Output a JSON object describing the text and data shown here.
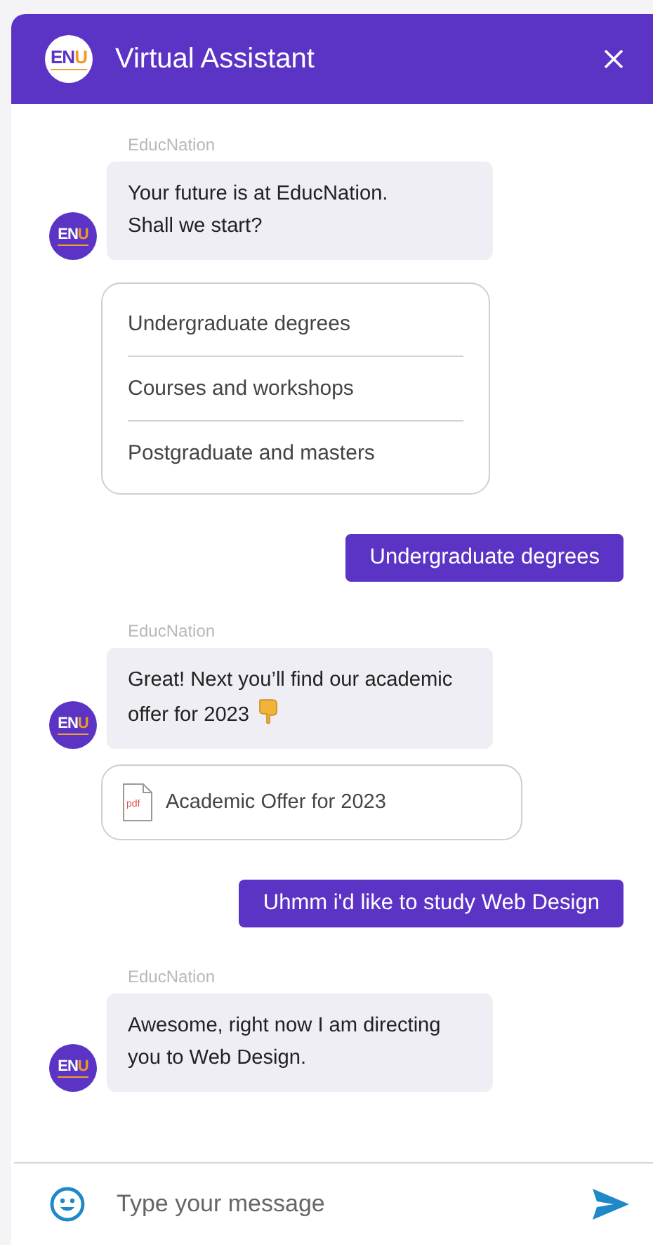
{
  "header": {
    "logo": {
      "main": "EN",
      "accent": "U"
    },
    "title": "Virtual Assistant"
  },
  "messages": [
    {
      "kind": "bot",
      "sender": "EducNation",
      "text": "Your future is at EducNation.\nShall we start?",
      "avatar": {
        "main": "EN",
        "accent": "U"
      }
    },
    {
      "kind": "options",
      "options": [
        "Undergraduate degrees",
        "Courses and workshops",
        "Postgraduate and masters"
      ]
    },
    {
      "kind": "user",
      "text": "Undergraduate degrees"
    },
    {
      "kind": "bot",
      "sender": "EducNation",
      "text": "Great! Next you’ll find our academic offer for 2023",
      "pointing_hand": true,
      "avatar": {
        "main": "EN",
        "accent": "U"
      }
    },
    {
      "kind": "file",
      "file_type": "pdf",
      "name": "Academic Offer for 2023"
    },
    {
      "kind": "user",
      "text": "Uhmm i'd like to study Web Design"
    },
    {
      "kind": "bot",
      "sender": "EducNation",
      "text": "Awesome, right now I am directing you to Web Design.",
      "avatar": {
        "main": "EN",
        "accent": "U"
      }
    }
  ],
  "composer": {
    "placeholder": "Type your message"
  }
}
